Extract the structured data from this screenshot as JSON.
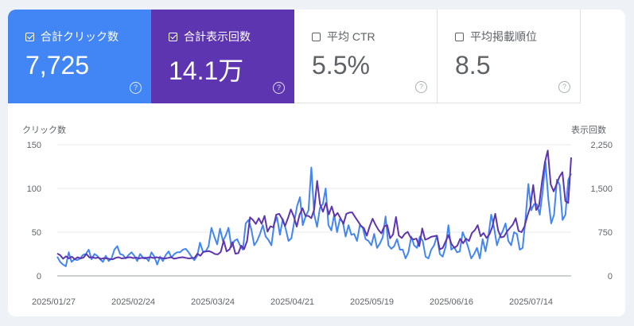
{
  "cards": [
    {
      "label": "合計クリック数",
      "value": "7,725",
      "checked": true
    },
    {
      "label": "合計表示回数",
      "value": "14.1万",
      "checked": true
    },
    {
      "label": "平均 CTR",
      "value": "5.5%",
      "checked": false
    },
    {
      "label": "平均掲載順位",
      "value": "8.5",
      "checked": false
    }
  ],
  "help_glyph": "?",
  "colors": {
    "clicks": "#4285f4",
    "impressions": "#5e35b1"
  },
  "chart_data": {
    "type": "line",
    "left_axis": {
      "title": "クリック数",
      "ticks": [
        0,
        50,
        100,
        150
      ],
      "ylim": [
        0,
        150
      ]
    },
    "right_axis": {
      "title": "表示回数",
      "ticks": [
        "0",
        "750",
        "1,500",
        "2,250"
      ],
      "ylim": [
        0,
        2250
      ]
    },
    "x_ticks": [
      "2025/01/27",
      "2025/02/24",
      "2025/03/24",
      "2025/04/21",
      "2025/05/19",
      "2025/06/16",
      "2025/07/14"
    ],
    "grid": true,
    "series": [
      {
        "axis": "left",
        "color": "#4285f4",
        "values": [
          22,
          16,
          13,
          11,
          27,
          16,
          19,
          18,
          20,
          24,
          25,
          30,
          19,
          25,
          23,
          19,
          16,
          23,
          17,
          20,
          30,
          34,
          25,
          24,
          20,
          24,
          27,
          23,
          17,
          25,
          21,
          21,
          17,
          27,
          22,
          13,
          22,
          17,
          24,
          28,
          21,
          25,
          27,
          27,
          30,
          31,
          27,
          22,
          18,
          23,
          38,
          28,
          28,
          34,
          55,
          45,
          36,
          54,
          40,
          46,
          55,
          33,
          40,
          42,
          35,
          30,
          60,
          64,
          53,
          35,
          40,
          48,
          58,
          45,
          41,
          35,
          60,
          67,
          47,
          65,
          54,
          40,
          43,
          62,
          80,
          90,
          58,
          68,
          75,
          124,
          70,
          56,
          78,
          82,
          100,
          58,
          52,
          70,
          50,
          65,
          62,
          45,
          58,
          47,
          48,
          40,
          58,
          55,
          42,
          40,
          35,
          48,
          32,
          37,
          44,
          68,
          35,
          31,
          34,
          42,
          30,
          30,
          20,
          27,
          45,
          35,
          32,
          45,
          40,
          22,
          20,
          30,
          35,
          46,
          25,
          22,
          33,
          58,
          30,
          33,
          27,
          28,
          50,
          42,
          32,
          20,
          25,
          32,
          20,
          42,
          28,
          45,
          70,
          55,
          35,
          45,
          51,
          60,
          40,
          35,
          50,
          48,
          30,
          32,
          65,
          105,
          75,
          82,
          82,
          70,
          96,
          130,
          88,
          60,
          70,
          110,
          104,
          64,
          70,
          110,
          117
        ]
      },
      {
        "axis": "right",
        "color": "#5e35b1",
        "values": [
          385,
          355,
          295,
          335,
          300,
          330,
          285,
          320,
          300,
          315,
          375,
          315,
          320,
          305,
          315,
          290,
          305,
          300,
          290,
          285,
          310,
          320,
          300,
          305,
          315,
          320,
          305,
          315,
          300,
          310,
          300,
          315,
          320,
          305,
          320,
          310,
          305,
          300,
          310,
          320,
          295,
          305,
          315,
          320,
          310,
          300,
          305,
          310,
          380,
          345,
          410,
          420,
          425,
          405,
          375,
          370,
          410,
          605,
          420,
          455,
          580,
          380,
          390,
          520,
          460,
          600,
          1005,
          960,
          890,
          990,
          895,
          1030,
          760,
          850,
          835,
          1050,
          1065,
          980,
          855,
          990,
          1140,
          1020,
          845,
          1050,
          1160,
          1030,
          1030,
          990,
          1140,
          1630,
          1230,
          1100,
          1250,
          1055,
          1190,
          1020,
          1080,
          990,
          890,
          1065,
          1085,
          1090,
          1010,
          935,
          860,
          820,
          690,
          850,
          980,
          875,
          790,
          730,
          850,
          870,
          645,
          710,
          1010,
          690,
          650,
          720,
          755,
          660,
          625,
          640,
          510,
          815,
          620,
          640,
          670,
          680,
          690,
          455,
          480,
          590,
          700,
          550,
          480,
          520,
          635,
          560,
          640,
          600,
          735,
          785,
          870,
          680,
          735,
          650,
          710,
          840,
          1065,
          780,
          660,
          675,
          760,
          820,
          880,
          990,
          770,
          750,
          845,
          1025,
          1180,
          1560,
          1130,
          1200,
          1610,
          1950,
          2150,
          1570,
          1450,
          1570,
          1700,
          1780,
          1285,
          1250,
          2030
        ]
      }
    ]
  }
}
